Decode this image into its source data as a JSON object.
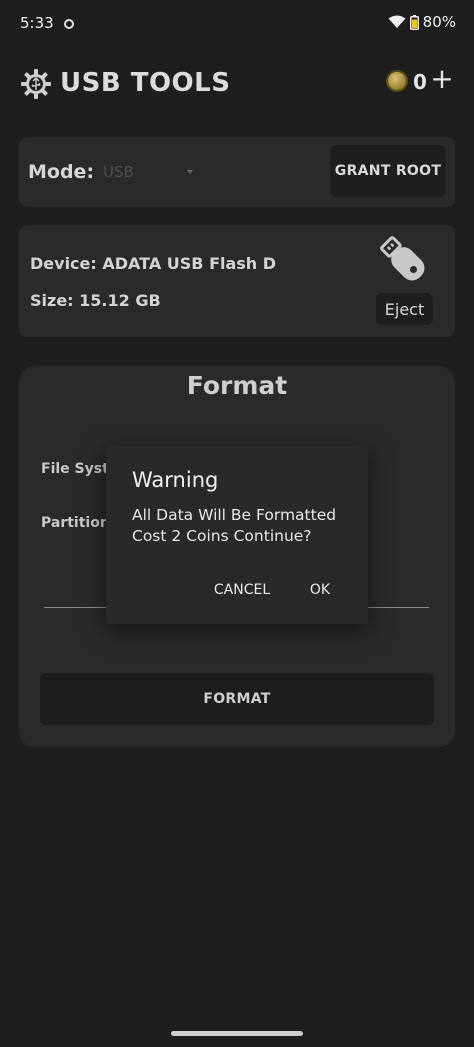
{
  "status_bar": {
    "time": "5:33",
    "battery_percent": "80%",
    "icons": [
      "wifi-icon",
      "battery-icon",
      "notification-dot-icon"
    ]
  },
  "header": {
    "title": "USB TOOLS",
    "coin_count": "0",
    "add_label": "+",
    "icons": [
      "gear-icon",
      "coin-icon"
    ]
  },
  "mode": {
    "label": "Mode:",
    "value": "USB",
    "grant_root_label": "GRANT ROOT"
  },
  "device": {
    "name_text": "Device: ADATA USB Flash D",
    "size_text": "Size: 15.12 GB",
    "eject_label": "Eject",
    "icon": "usb-drive-icon"
  },
  "format": {
    "title": "Format",
    "file_system_label": "File System",
    "partition_label": "Partition",
    "button_label": "FORMAT"
  },
  "dialog": {
    "title": "Warning",
    "message_line1": "All Data Will Be Formatted",
    "message_line2": "Cost 2 Coins Continue?",
    "cancel_label": "CANCEL",
    "ok_label": "OK"
  },
  "colors": {
    "background": "#1e1e1e",
    "card": "#2a2a2a",
    "dialog": "#292929",
    "button": "#1d1d1d",
    "coin": "#a38936",
    "battery_fill": "#f0c419"
  }
}
